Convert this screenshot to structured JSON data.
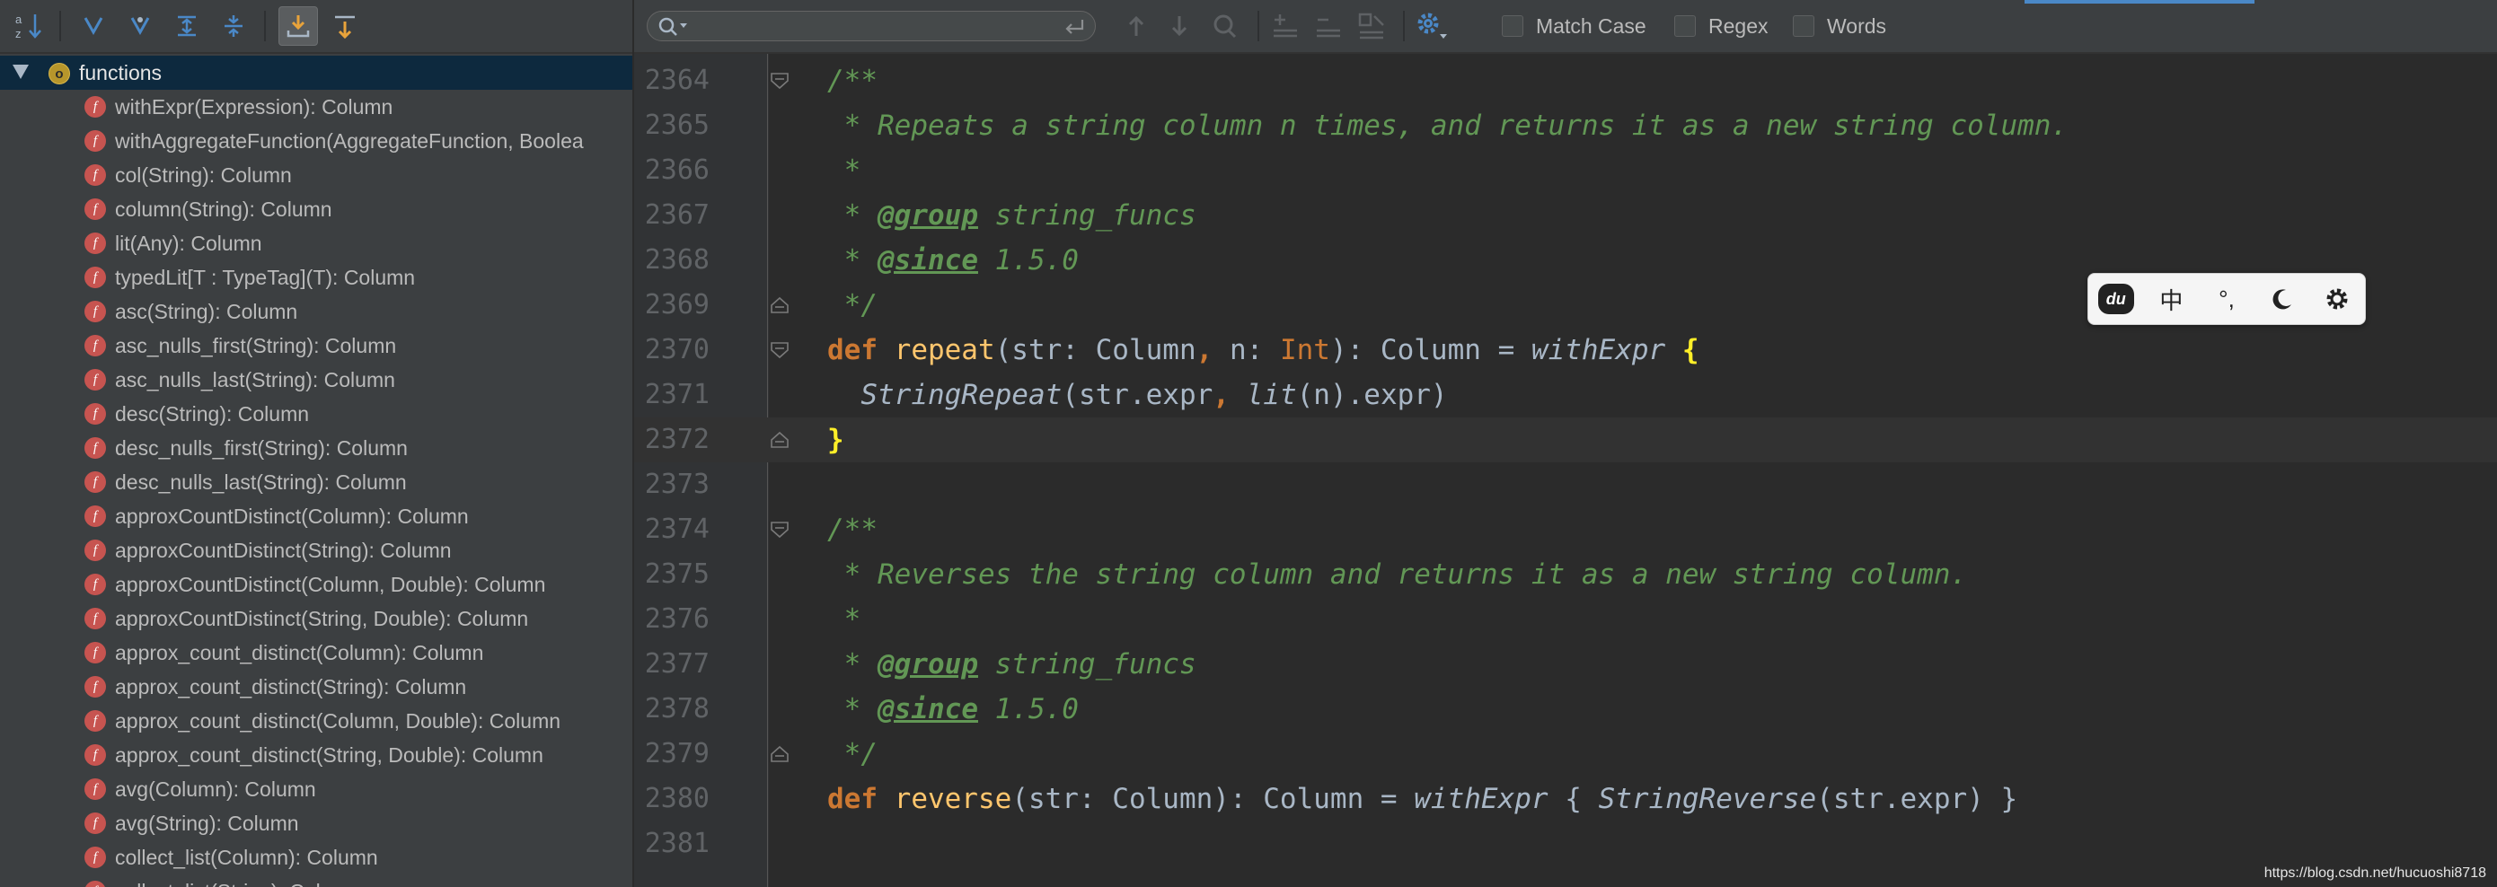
{
  "structure": {
    "root_label": "functions",
    "root_icon": "object-icon",
    "items": [
      {
        "label": "withExpr(Expression): Column"
      },
      {
        "label": "withAggregateFunction(AggregateFunction, Boolea"
      },
      {
        "label": "col(String): Column"
      },
      {
        "label": "column(String): Column"
      },
      {
        "label": "lit(Any): Column"
      },
      {
        "label": "typedLit[T : TypeTag](T): Column"
      },
      {
        "label": "asc(String): Column"
      },
      {
        "label": "asc_nulls_first(String): Column"
      },
      {
        "label": "asc_nulls_last(String): Column"
      },
      {
        "label": "desc(String): Column"
      },
      {
        "label": "desc_nulls_first(String): Column"
      },
      {
        "label": "desc_nulls_last(String): Column"
      },
      {
        "label": "approxCountDistinct(Column): Column"
      },
      {
        "label": "approxCountDistinct(String): Column"
      },
      {
        "label": "approxCountDistinct(Column, Double): Column"
      },
      {
        "label": "approxCountDistinct(String, Double): Column"
      },
      {
        "label": "approx_count_distinct(Column): Column"
      },
      {
        "label": "approx_count_distinct(String): Column"
      },
      {
        "label": "approx_count_distinct(Column, Double): Column"
      },
      {
        "label": "approx_count_distinct(String, Double): Column"
      },
      {
        "label": "avg(Column): Column"
      },
      {
        "label": "avg(String): Column"
      },
      {
        "label": "collect_list(Column): Column"
      },
      {
        "label": "collect_list(String): Column"
      }
    ],
    "function_icon_letter": "f"
  },
  "findbar": {
    "search_value": "",
    "match_case_label": "Match Case",
    "regex_label": "Regex",
    "words_label": "Words",
    "match_case_checked": false,
    "regex_checked": false,
    "words_checked": false
  },
  "code_lines": [
    {
      "num": "2364"
    },
    {
      "num": "2365"
    },
    {
      "num": "2366"
    },
    {
      "num": "2367"
    },
    {
      "num": "2368"
    },
    {
      "num": "2369"
    },
    {
      "num": "2370"
    },
    {
      "num": "2371"
    },
    {
      "num": "2372"
    },
    {
      "num": "2373"
    },
    {
      "num": "2374"
    },
    {
      "num": "2375"
    },
    {
      "num": "2376"
    },
    {
      "num": "2377"
    },
    {
      "num": "2378"
    },
    {
      "num": "2379"
    },
    {
      "num": "2380"
    },
    {
      "num": "2381"
    }
  ],
  "code": {
    "l2364": "/**",
    "l2365": " * Repeats a string column n times, and returns it as a new string column.",
    "l2366": " *",
    "l2367_star": " * ",
    "l2367_tag": "@group",
    "l2367_rest": " string_funcs",
    "l2368_star": " * ",
    "l2368_tag": "@since",
    "l2368_rest": " 1.5.0",
    "l2369": " */",
    "l2370_def": "def ",
    "l2370_fn": "repeat",
    "l2370_a": "(str: Column",
    "l2370_comma": ",",
    "l2370_b": " n: ",
    "l2370_int": "Int",
    "l2370_c": "): Column = ",
    "l2370_with": "withExpr",
    "l2370_sp": " ",
    "l2370_brace": "{",
    "l2371_indent": "  ",
    "l2371_repeat": "StringRepeat",
    "l2371_a": "(str.expr",
    "l2371_comma": ",",
    "l2371_sp": " ",
    "l2371_lit": "lit",
    "l2371_b": "(n).expr)",
    "l2372_brace": "}",
    "l2374": "/**",
    "l2375": " * Reverses the string column and returns it as a new string column.",
    "l2376": " *",
    "l2377_star": " * ",
    "l2377_tag": "@group",
    "l2377_rest": " string_funcs",
    "l2378_star": " * ",
    "l2378_tag": "@since",
    "l2378_rest": " 1.5.0",
    "l2379": " */",
    "l2380_def": "def ",
    "l2380_fn": "reverse",
    "l2380_a": "(str: Column): Column = ",
    "l2380_with": "withExpr",
    "l2380_b": " { ",
    "l2380_rev": "StringReverse",
    "l2380_c": "(str.expr) }"
  },
  "ime": {
    "logo": "du",
    "chinese_label": "中",
    "punct_label": "°,"
  },
  "watermark": "https://blog.csdn.net/hucuoshi8718",
  "colors": {
    "panel_bg": "#3c3f41",
    "editor_bg": "#2b2b2b",
    "selection": "#0d293e",
    "doc_comment": "#629755",
    "keyword": "#cc7832",
    "function_name": "#ffc66d"
  }
}
